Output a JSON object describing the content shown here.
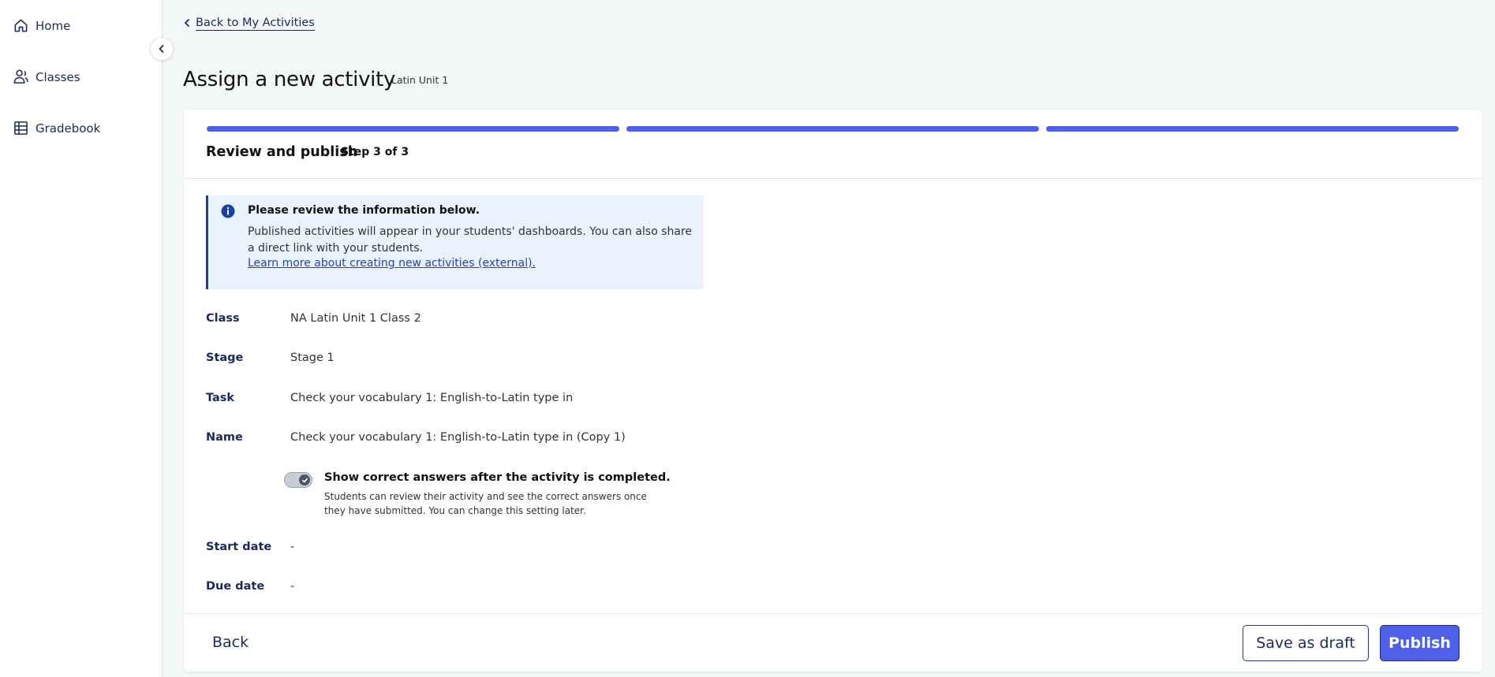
{
  "sidebar": {
    "items": [
      {
        "label": "Home",
        "icon": "home-icon"
      },
      {
        "label": "Classes",
        "icon": "classes-icon"
      },
      {
        "label": "Gradebook",
        "icon": "gradebook-icon"
      }
    ],
    "collapse_icon": "chevron-left-icon"
  },
  "header": {
    "back_label": "Back to My Activities",
    "title": "Assign a new activity",
    "unit_tag": "Latin Unit 1"
  },
  "wizard": {
    "step_title": "Review and publish",
    "step_label": "Step 3 of 3",
    "progress_color": "#4f5fe8",
    "steps_completed": 3,
    "steps_total": 3
  },
  "info": {
    "title": "Please review the information below.",
    "body": "Published activities will appear in your students' dashboards. You can also share a direct link with your students.",
    "link": "Learn more about creating new activities (external)."
  },
  "details": {
    "class_label": "Class",
    "class_value": "NA Latin Unit 1 Class 2",
    "stage_label": "Stage",
    "stage_value": "Stage 1",
    "task_label": "Task",
    "task_value": "Check your vocabulary 1: English-to-Latin type in",
    "name_label": "Name",
    "name_value": "Check your vocabulary 1: English-to-Latin type in (Copy 1)",
    "start_label": "Start date",
    "start_value": "-",
    "due_label": "Due date",
    "due_value": "-"
  },
  "toggle": {
    "checked": true,
    "title": "Show correct answers after the activity is completed.",
    "description": "Students can review their activity and see the correct answers once they have submitted. You can change this setting later."
  },
  "footer": {
    "back": "Back",
    "draft": "Save as draft",
    "publish": "Publish"
  }
}
